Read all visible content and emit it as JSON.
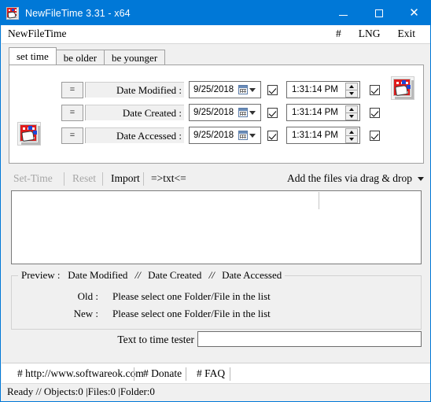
{
  "window": {
    "title": "NewFileTime 3.31 - x64",
    "icon": "app-grid-icon",
    "minimize": "minimize-icon",
    "maximize": "maximize-icon",
    "close": "close-icon",
    "accent_color": "#0078d7"
  },
  "menubar": {
    "app_name": "NewFileTime",
    "items": [
      "#",
      "LNG",
      "Exit"
    ]
  },
  "tabs": [
    {
      "label": "set time",
      "active": true
    },
    {
      "label": "be older",
      "active": false
    },
    {
      "label": "be younger",
      "active": false
    }
  ],
  "rows": [
    {
      "eq": "=",
      "label": "Date Modified :",
      "date": "9/25/2018",
      "date_checked": true,
      "time": "1:31:14 PM",
      "time_checked": true
    },
    {
      "eq": "=",
      "label": "Date Created :",
      "date": "9/25/2018",
      "date_checked": true,
      "time": "1:31:14 PM",
      "time_checked": true
    },
    {
      "eq": "=",
      "label": "Date Accessed :",
      "date": "9/25/2018",
      "date_checked": true,
      "time": "1:31:14 PM",
      "time_checked": true
    }
  ],
  "toolbar": {
    "set_time": "Set-Time",
    "set_time_enabled": false,
    "reset": "Reset",
    "reset_enabled": false,
    "import": "Import",
    "txt": "=>txt<=",
    "dropdown": "Add the files via drag & drop"
  },
  "list": {
    "items": []
  },
  "preview": {
    "legend_title": "Preview :",
    "legend_col1": "Date Modified",
    "legend_sep1": "//",
    "legend_col2": "Date Created",
    "legend_sep2": "//",
    "legend_col3": "Date Accessed",
    "old_label": "Old :",
    "old_value": "Please select one Folder/File in the list",
    "new_label": "New :",
    "new_value": "Please select one Folder/File in the list"
  },
  "tester": {
    "label": "Text to time tester",
    "value": "",
    "placeholder": ""
  },
  "linkbar": {
    "website": "# http://www.softwareok.com",
    "donate": "# Donate",
    "faq": "# FAQ"
  },
  "statusbar": {
    "text": "Ready // Objects:0 |Files:0  |Folder:0"
  }
}
